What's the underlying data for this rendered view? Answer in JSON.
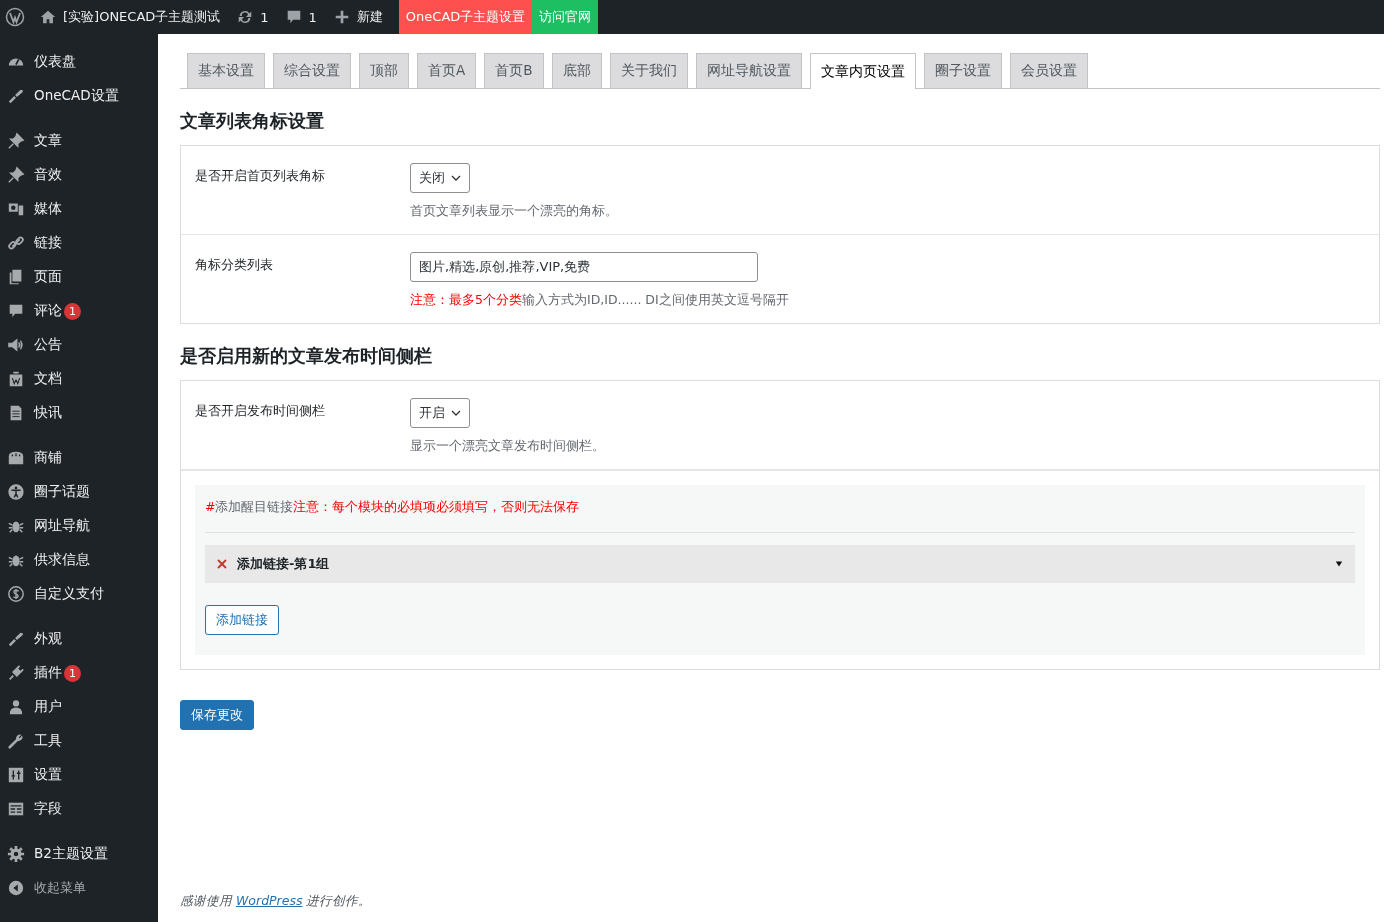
{
  "admin_bar": {
    "site_title": "[实验]ONECAD子主题测试",
    "updates": "1",
    "comments": "1",
    "new_label": "新建",
    "buttons": [
      {
        "label": "OneCAD子主题设置",
        "color": "#ff5050"
      },
      {
        "label": "访问官网",
        "color": "#1ebf63"
      }
    ]
  },
  "sidebar": {
    "groups": [
      {
        "items": [
          {
            "label": "仪表盘",
            "kind": "menu"
          },
          {
            "label": "OneCAD设置",
            "kind": "menu"
          }
        ]
      },
      {
        "items": [
          {
            "label": "文章",
            "kind": "menu"
          },
          {
            "label": "音效",
            "kind": "menu"
          },
          {
            "label": "媒体",
            "kind": "menu"
          },
          {
            "label": "链接",
            "kind": "menu"
          },
          {
            "label": "页面",
            "kind": "menu"
          },
          {
            "label": "评论",
            "kind": "menu",
            "badge": "1"
          },
          {
            "label": "公告",
            "kind": "menu"
          },
          {
            "label": "文档",
            "kind": "menu"
          },
          {
            "label": "快讯",
            "kind": "menu"
          }
        ]
      },
      {
        "items": [
          {
            "label": "商铺",
            "kind": "menu"
          },
          {
            "label": "圈子话题",
            "kind": "menu"
          },
          {
            "label": "网址导航",
            "kind": "menu"
          },
          {
            "label": "供求信息",
            "kind": "menu"
          },
          {
            "label": "自定义支付",
            "kind": "menu"
          }
        ]
      },
      {
        "items": [
          {
            "label": "外观",
            "kind": "menu"
          },
          {
            "label": "插件",
            "kind": "menu",
            "badge": "1"
          },
          {
            "label": "用户",
            "kind": "menu"
          },
          {
            "label": "工具",
            "kind": "menu"
          },
          {
            "label": "设置",
            "kind": "menu"
          },
          {
            "label": "字段",
            "kind": "menu"
          }
        ]
      },
      {
        "items": [
          {
            "label": "B2主题设置",
            "kind": "menu"
          },
          {
            "label": "收起菜单",
            "kind": "collapse"
          }
        ]
      }
    ]
  },
  "tabs": [
    {
      "label": "基本设置",
      "selected": false
    },
    {
      "label": "综合设置",
      "selected": false
    },
    {
      "label": "顶部",
      "selected": false
    },
    {
      "label": "首页A",
      "selected": false
    },
    {
      "label": "首页B",
      "selected": false
    },
    {
      "label": "底部",
      "selected": false
    },
    {
      "label": "关于我们",
      "selected": false
    },
    {
      "label": "网址导航设置",
      "selected": false
    },
    {
      "label": "文章内页设置",
      "selected": true
    },
    {
      "label": "圈子设置",
      "selected": false
    },
    {
      "label": "会员设置",
      "selected": false
    }
  ],
  "sections": [
    {
      "title": "文章列表角标设置",
      "rows": [
        {
          "label": "是否开启首页列表角标",
          "kind": "select",
          "value": "关闭",
          "help": "首页文章列表显示一个漂亮的角标。"
        },
        {
          "label": "角标分类列表",
          "kind": "text",
          "value": "图片,精选,原创,推荐,VIP,免费",
          "note": "注意：最多5个分类",
          "help": "输入方式为ID,ID...... DI之间使用英文逗号隔开"
        }
      ]
    },
    {
      "title": "是否启用新的文章发布时间侧栏",
      "rows": [
        {
          "label": "是否开启发布时间侧栏",
          "kind": "select",
          "value": "开启",
          "help": "显示一个漂亮文章发布时间侧栏。"
        }
      ],
      "repeater": {
        "mark": "#",
        "label": "添加醒目链接",
        "warning": "注意：每个模块的必填项必须填写，否则无法保存",
        "groups": [
          {
            "title": "添加链接-第1组",
            "expanded": false
          }
        ],
        "add_button": "添加链接"
      }
    }
  ],
  "save_button": "保存更改",
  "footer": {
    "before": "感谢使用 ",
    "link": "WordPress",
    "after": " 进行创作。"
  }
}
